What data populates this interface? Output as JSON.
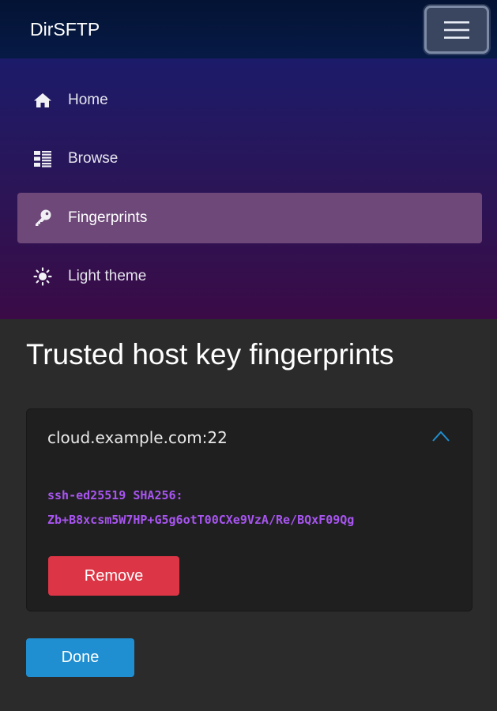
{
  "header": {
    "brand": "DirSFTP",
    "menu_icon": "hamburger-menu-icon"
  },
  "nav": {
    "items": [
      {
        "label": "Home",
        "icon": "home-icon",
        "active": false
      },
      {
        "label": "Browse",
        "icon": "list-icon",
        "active": false
      },
      {
        "label": "Fingerprints",
        "icon": "key-icon",
        "active": true
      },
      {
        "label": "Light theme",
        "icon": "sun-icon",
        "active": false
      }
    ]
  },
  "main": {
    "title": "Trusted host key fingerprints",
    "hosts": [
      {
        "host": "cloud.example.com:22",
        "fingerprint_line1": "ssh-ed25519 SHA256:",
        "fingerprint_line2": "Zb+B8xcsm5W7HP+G5g6otT00CXe9VzA/Re/BQxF09Qg",
        "remove_label": "Remove",
        "expanded": true
      }
    ],
    "done_label": "Done"
  },
  "colors": {
    "active_nav": "#6d4878",
    "fingerprint": "#a855f0",
    "remove": "#dc3545",
    "done": "#1f8fd1"
  }
}
